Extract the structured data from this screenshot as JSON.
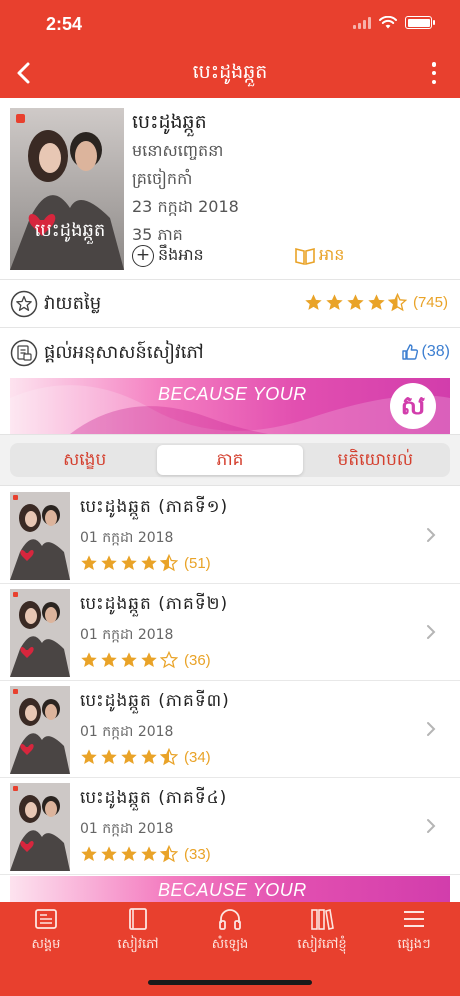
{
  "status_bar": {
    "time": "2:54"
  },
  "navbar": {
    "title": "បេះដូងឆ្កួត"
  },
  "book": {
    "title": "បេះដូងឆ្កួត",
    "author": "មនោសញ្ចេតនា",
    "publisher": "គ្រចៀកកាំ",
    "date": "23 កក្កដា 2018",
    "episodes": "35 ភាគ",
    "add_label": "នឹងអាន",
    "read_label": "អាន",
    "cover_title": "បេះដូងឆ្កួត"
  },
  "rating": {
    "label": "វាយតម្លៃ",
    "count": "(745)",
    "stars": 4.5
  },
  "translate": {
    "label": "ផ្តល់អនុសាសន៍សៀវភៅ",
    "likes": "(38)"
  },
  "banner": {
    "text": "BECAUSE YOUR",
    "logo": "ស"
  },
  "segments": {
    "items": [
      "សង្ខេប",
      "ភាគ",
      "មតិយោបល់"
    ],
    "active": 1
  },
  "episodes": [
    {
      "title": "បេះដូងឆ្កួត (ភាគទី១)",
      "date": "01 កក្កដា 2018",
      "stars": 4.5,
      "count": "(51)"
    },
    {
      "title": "បេះដូងឆ្កួត (ភាគទី២)",
      "date": "01 កក្កដា 2018",
      "stars": 4,
      "count": "(36)"
    },
    {
      "title": "បេះដូងឆ្កួត (ភាគទី៣)",
      "date": "01 កក្កដា 2018",
      "stars": 4.5,
      "count": "(34)"
    },
    {
      "title": "បេះដូងឆ្កួត (ភាគទី៤)",
      "date": "01 កក្កដា 2018",
      "stars": 4.5,
      "count": "(33)"
    }
  ],
  "tabs": [
    {
      "label": "សង្គម",
      "icon": "news-icon"
    },
    {
      "label": "សៀវភៅ",
      "icon": "book-icon"
    },
    {
      "label": "សំឡេង",
      "icon": "headphones-icon"
    },
    {
      "label": "សៀវភៅខ្ញុំ",
      "icon": "library-icon"
    },
    {
      "label": "ផ្សេងៗ",
      "icon": "menu-icon"
    }
  ],
  "colors": {
    "primary": "#e8402e",
    "star": "#e9a328",
    "link": "#3d7fd1"
  }
}
